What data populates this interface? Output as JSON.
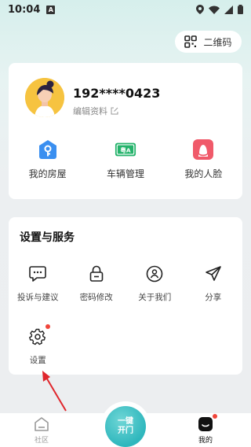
{
  "status_bar": {
    "time": "10:04",
    "badge": "A"
  },
  "header": {
    "qr_label": "二维码"
  },
  "profile": {
    "username": "192****0423",
    "edit_label": "编辑资料",
    "shortcuts": [
      {
        "label": "我的房屋",
        "icon": "house-key-icon",
        "color": "#3a8ff0"
      },
      {
        "label": "车辆管理",
        "icon": "license-plate-icon",
        "color": "#24b36b"
      },
      {
        "label": "我的人脸",
        "icon": "face-icon",
        "color": "#f05a6a"
      }
    ]
  },
  "services": {
    "title": "设置与服务",
    "items": [
      {
        "label": "投诉与建议",
        "icon": "chat-bubble-icon"
      },
      {
        "label": "密码修改",
        "icon": "lock-icon"
      },
      {
        "label": "关于我们",
        "icon": "smiley-circle-icon"
      },
      {
        "label": "分享",
        "icon": "paper-plane-icon"
      }
    ],
    "settings": {
      "label": "设置",
      "icon": "gear-icon"
    }
  },
  "tabbar": {
    "community": "社区",
    "unlock_line1": "一键",
    "unlock_line2": "开门",
    "mine": "我的"
  },
  "colors": {
    "accent": "#2fb7bd",
    "badge_red": "#f0453a",
    "annotation_arrow": "#e0262c"
  }
}
